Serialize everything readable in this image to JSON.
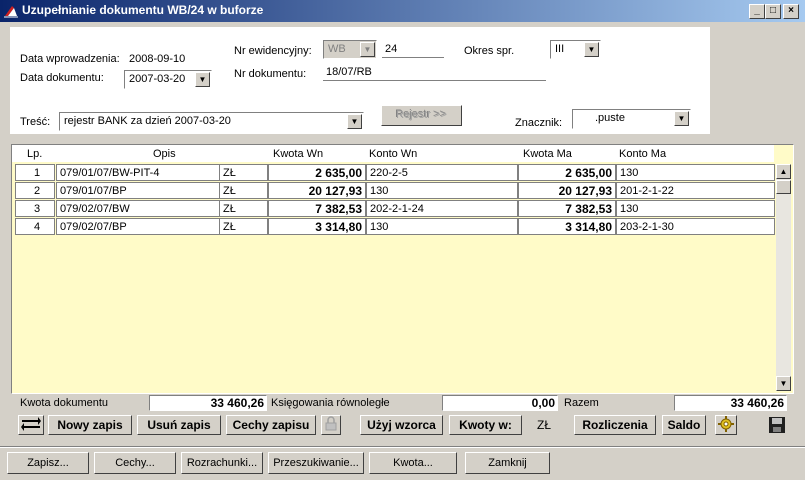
{
  "window": {
    "title": "Uzupełnianie dokumentu WB/24 w buforze",
    "buttons": {
      "minimize": "_",
      "maximize": "□",
      "close": "×"
    }
  },
  "header": {
    "data_wprowadzenia_label": "Data wprowadzenia:",
    "data_wprowadzenia_value": "2008-09-10",
    "data_dokumentu_label": "Data dokumentu:",
    "data_dokumentu_value": "2007-03-20",
    "nr_ewidencyjny_label": "Nr ewidencyjny:",
    "nr_ewidencyjny_prefix": "WB",
    "nr_ewidencyjny_value": "24",
    "okres_label": "Okres spr.",
    "okres_value": "III",
    "nr_dokumentu_label": "Nr dokumentu:",
    "nr_dokumentu_value": "18/07/RB",
    "tresc_label": "Treść:",
    "tresc_value": "rejestr BANK za dzień 2007-03-20",
    "rejestr_button": "Rejestr >>",
    "znacznik_label": "Znacznik:",
    "znacznik_value": ".puste"
  },
  "table": {
    "columns": [
      "Lp.",
      "Opis",
      "Kwota Wn",
      "Konto Wn",
      "Kwota Ma",
      "Konto Ma"
    ],
    "rows": [
      {
        "lp": "1",
        "opis": "079/01/07/BW-PIT-4",
        "waluta": "ZŁ",
        "kwota_wn": "2 635,00",
        "konto_wn": "220-2-5",
        "kwota_ma": "2 635,00",
        "konto_ma": "130"
      },
      {
        "lp": "2",
        "opis": "079/01/07/BP",
        "waluta": "ZŁ",
        "kwota_wn": "20 127,93",
        "konto_wn": "130",
        "kwota_ma": "20 127,93",
        "konto_ma": "201-2-1-22"
      },
      {
        "lp": "3",
        "opis": "079/02/07/BW",
        "waluta": "ZŁ",
        "kwota_wn": "7 382,53",
        "konto_wn": "202-2-1-24",
        "kwota_ma": "7 382,53",
        "konto_ma": "130"
      },
      {
        "lp": "4",
        "opis": "079/02/07/BP",
        "waluta": "ZŁ",
        "kwota_wn": "3 314,80",
        "konto_wn": "130",
        "kwota_ma": "3 314,80",
        "konto_ma": "203-2-1-30"
      }
    ]
  },
  "totals": {
    "kwota_dokumentu_label": "Kwota dokumentu",
    "kwota_dokumentu_value": "33 460,26",
    "ksiegowania_label": "Księgowania równoległe",
    "ksiegowania_value": "0,00",
    "razem_label": "Razem",
    "razem_value": "33 460,26"
  },
  "actions": {
    "nowy_zapis": "Nowy zapis",
    "usun_zapis": "Usuń zapis",
    "cechy_zapisu": "Cechy zapisu",
    "uzyj_wzorca": "Użyj wzorca",
    "kwoty_w": "Kwoty w:",
    "waluta": "ZŁ",
    "rozliczenia": "Rozliczenia",
    "saldo": "Saldo"
  },
  "bottom": {
    "zapisz": "Zapisz...",
    "cechy": "Cechy...",
    "rozrachunki": "Rozrachunki...",
    "przeszukiwanie": "Przeszukiwanie...",
    "kwota": "Kwota...",
    "zamknij": "Zamknij"
  },
  "colors": {
    "title_start": "#0a246a",
    "title_end": "#a6caf0",
    "grid_background": "#fffbc8",
    "face": "#d4d0c8"
  },
  "icons": [
    "app-logo-icon",
    "swap-arrows-icon",
    "lock-icon",
    "settings-gear-icon",
    "save-disk-icon"
  ]
}
